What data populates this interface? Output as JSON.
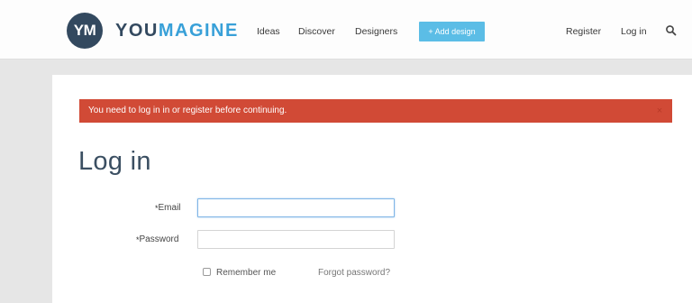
{
  "brand": {
    "badge": "YM",
    "name_part1": "YOU",
    "name_part2": "MAGINE",
    "primary_color": "#33495f",
    "accent_color": "#38a0d8"
  },
  "nav": {
    "items": [
      {
        "label": "Ideas"
      },
      {
        "label": "Discover"
      },
      {
        "label": "Designers"
      }
    ],
    "add_design_label": "+ Add design",
    "add_design_color": "#5bbde6",
    "register_label": "Register",
    "login_label": "Log in",
    "search_icon": "search-icon"
  },
  "alert": {
    "message": "You need to log in in or register before continuing.",
    "close_glyph": "×",
    "color": "#d14a36"
  },
  "form": {
    "title": "Log in",
    "required_marker": "*",
    "email_label": "Email",
    "email_value": "",
    "password_label": "Password",
    "password_value": "",
    "remember_label": "Remember me",
    "remember_checked": false,
    "forgot_label": "Forgot password?"
  }
}
